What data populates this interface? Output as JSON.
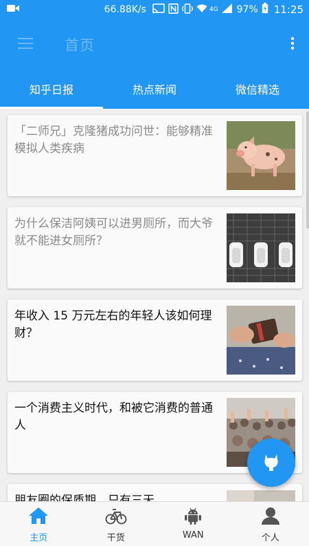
{
  "status_bar": {
    "network_speed": "66.88K/s",
    "signal_type": "4G",
    "battery": "97%",
    "time": "11:25",
    "icons": [
      "video-icon",
      "cast-icon",
      "nfc-icon",
      "vibrate-icon",
      "wifi-icon",
      "signal-icon",
      "battery-icon"
    ]
  },
  "app_bar": {
    "title": "首页",
    "icons": [
      "menu-icon",
      "more-vert-icon"
    ]
  },
  "tabs": [
    {
      "label": "知乎日报",
      "active": true
    },
    {
      "label": "热点新闻",
      "active": false
    },
    {
      "label": "微信精选",
      "active": false
    }
  ],
  "feed": {
    "items": [
      {
        "title": "「二师兄」克隆猪成功问世：能够精准模拟人类疾病",
        "read": true,
        "image": "piglet-photo"
      },
      {
        "title": "为什么保洁阿姨可以进男厕所，而大爷就不能进女厕所？",
        "read": true,
        "image": "urinals-photo"
      },
      {
        "title": "年收入 15 万元左右的年轻人该如何理财？",
        "read": false,
        "image": "wallet-photo"
      },
      {
        "title": "一个消费主义时代，和被它消费的普通人",
        "read": false,
        "image": "crowd-photo"
      },
      {
        "title": "朋友圈的保质期，只有三天",
        "read": false,
        "image": "partial-photo"
      }
    ]
  },
  "fab": {
    "icon": "github-icon"
  },
  "bottom_nav": {
    "items": [
      {
        "label": "主页",
        "icon": "home-icon",
        "active": true
      },
      {
        "label": "干货",
        "icon": "bicycle-icon",
        "active": false
      },
      {
        "label": "WAN",
        "icon": "android-icon",
        "active": false
      },
      {
        "label": "个人",
        "icon": "person-icon",
        "active": false
      }
    ]
  },
  "colors": {
    "primary": "#2196f3",
    "title_muted": "#6eb8f5",
    "read_text": "#8a8a8a",
    "unread_text": "#111111",
    "nav_inactive_icon": "#555555"
  }
}
